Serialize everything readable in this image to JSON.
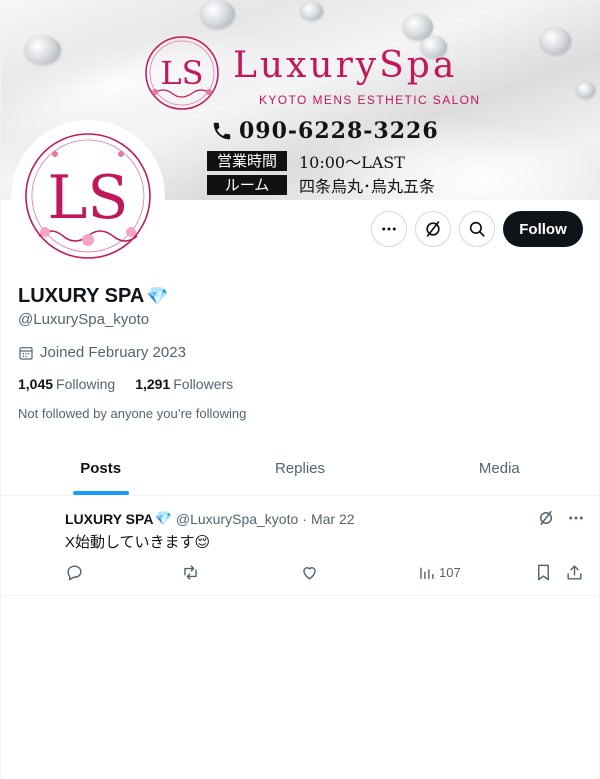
{
  "banner": {
    "brand_title": "LuxurySpa",
    "brand_sub": "KYOTO MENS ESTHETIC SALON",
    "phone": "090-6228-3226",
    "hours_tag": "営業時間",
    "hours_value": "10:00～LAST",
    "room_tag": "ルーム",
    "room_value": "四条烏丸･烏丸五条",
    "emblem_text": "LS"
  },
  "profile": {
    "name": "LUXURY SPA",
    "name_emoji": "💎",
    "handle": "@LuxurySpa_kyoto",
    "joined": "Joined February 2023",
    "following_count": "1,045",
    "following_label": "Following",
    "followers_count": "1,291",
    "followers_label": "Followers",
    "not_followed": "Not followed by anyone you’re following"
  },
  "actions": {
    "follow_label": "Follow",
    "more_icon": "more-icon",
    "grok_icon": "grok-icon",
    "search_icon": "search-icon"
  },
  "tabs": [
    {
      "label": "Posts",
      "active": true
    },
    {
      "label": "Replies",
      "active": false
    },
    {
      "label": "Media",
      "active": false
    }
  ],
  "posts": [
    {
      "name": "LUXURY SPA",
      "name_emoji": "💎",
      "handle": "@LuxurySpa_kyoto",
      "sep": "·",
      "date": "Mar 22",
      "text": "X始動していきます😌",
      "views": "107"
    }
  ],
  "colors": {
    "brand_pink": "#c2185b",
    "accent_blue": "#1d9bf0",
    "text_primary": "#0f1419",
    "text_secondary": "#536471"
  }
}
